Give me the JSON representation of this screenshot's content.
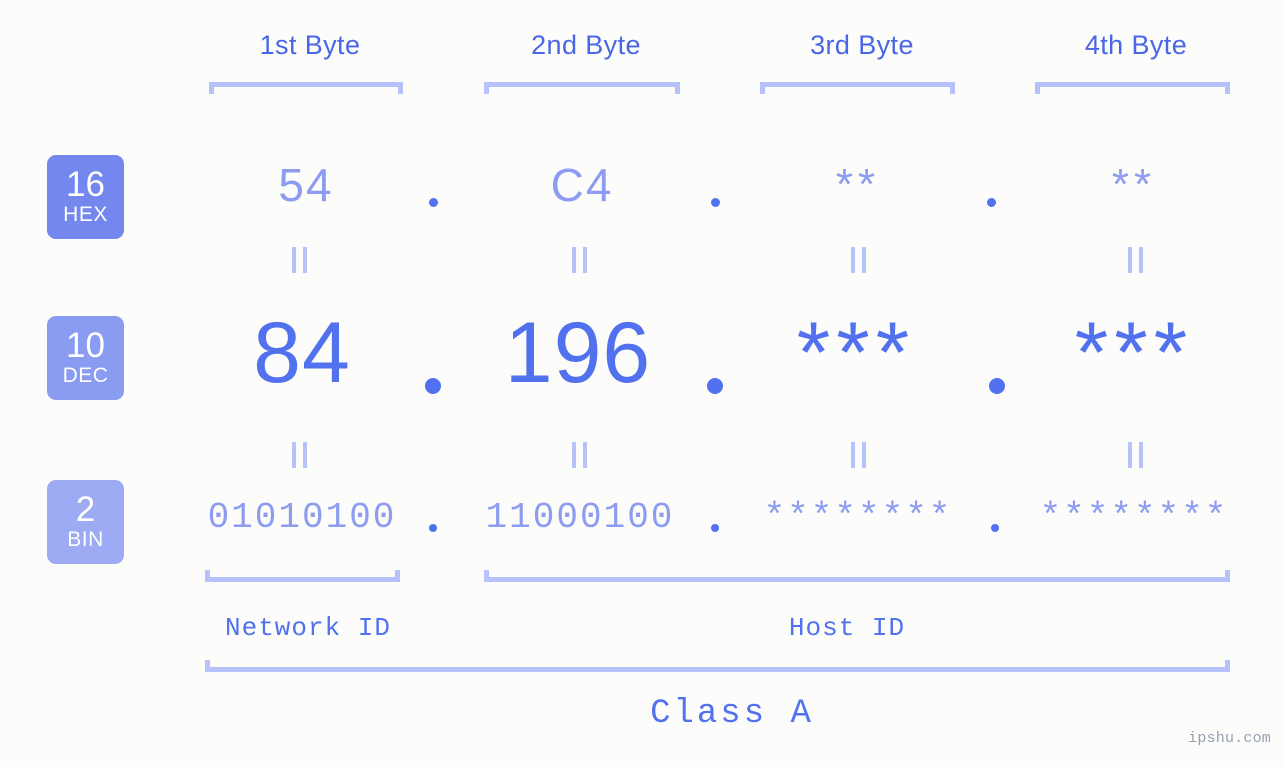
{
  "page": {
    "background_color": "#fcfdfa",
    "accent_color": "#5271ef",
    "accent_light_color": "#8d9cf1",
    "bracket_color": "#b7c1fb",
    "watermark": "ipshu.com"
  },
  "byte_headers": [
    {
      "label": "1st Byte"
    },
    {
      "label": "2nd Byte"
    },
    {
      "label": "3rd Byte"
    },
    {
      "label": "4th Byte"
    }
  ],
  "radix_badges": [
    {
      "number": "16",
      "label": "HEX",
      "color": "#7387ee"
    },
    {
      "number": "10",
      "label": "DEC",
      "color": "#8a9bf2"
    },
    {
      "number": "2",
      "label": "BIN",
      "color": "#9cabf4"
    }
  ],
  "rows": {
    "hex": {
      "radix": "16",
      "radix_name": "HEX",
      "values": [
        "54",
        "C4",
        "**",
        "**"
      ],
      "separator": "."
    },
    "dec": {
      "radix": "10",
      "radix_name": "DEC",
      "values": [
        "84",
        "196",
        "***",
        "***"
      ],
      "separator": "."
    },
    "bin": {
      "radix": "2",
      "radix_name": "BIN",
      "values": [
        "01010100",
        "11000100",
        "********",
        "********"
      ],
      "separator": "."
    }
  },
  "equals_marker": "||",
  "segments": {
    "network_id": "Network ID",
    "host_id": "Host ID",
    "class": "Class A"
  }
}
